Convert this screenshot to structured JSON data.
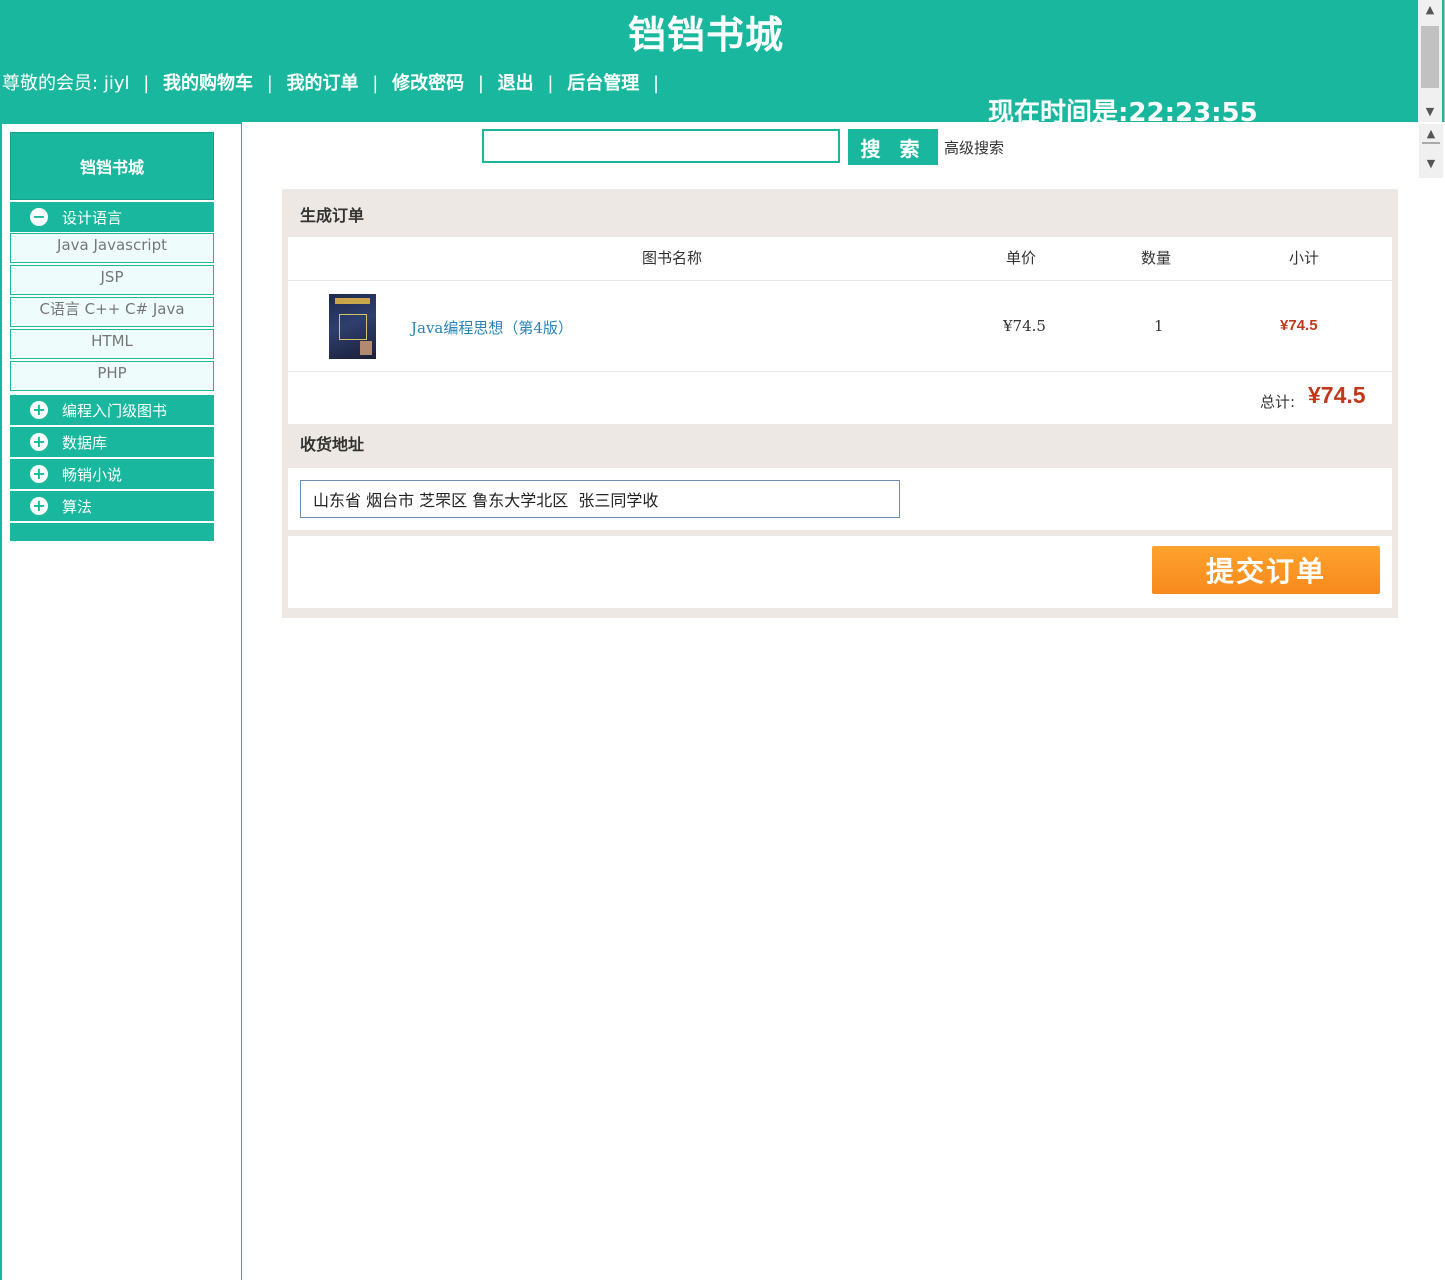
{
  "header": {
    "site_title": "铛铛书城",
    "member_prefix": "尊敬的会员:",
    "member_name": "jiyl",
    "nav": {
      "cart": "我的购物车",
      "orders": "我的订单",
      "change_password": "修改密码",
      "logout": "退出",
      "admin": "后台管理"
    },
    "separator": "|",
    "clock": "现在时间是:22:23:55"
  },
  "sidebar": {
    "title": "铛铛书城",
    "categories": [
      {
        "label": "设计语言",
        "icon": "minus-circle-icon",
        "expanded": true,
        "children": [
          "Java Javascript",
          "JSP",
          "C语言 C++ C# Java",
          "HTML",
          "PHP"
        ]
      },
      {
        "label": "编程入门级图书",
        "icon": "plus-circle-icon"
      },
      {
        "label": "数据库",
        "icon": "plus-circle-icon"
      },
      {
        "label": "畅销小说",
        "icon": "plus-circle-icon"
      },
      {
        "label": "算法",
        "icon": "plus-circle-icon"
      }
    ]
  },
  "search": {
    "value": "",
    "button_label": "搜 索",
    "advanced_label": "高级搜索"
  },
  "order": {
    "title": "生成订单",
    "columns": {
      "name": "图书名称",
      "price": "单价",
      "qty": "数量",
      "subtotal": "小计"
    },
    "items": [
      {
        "name": "Java编程思想（第4版）",
        "price": "¥74.5",
        "qty": "1",
        "subtotal": "¥74.5"
      }
    ],
    "total_label": "总计:",
    "total_value": "¥74.5"
  },
  "address": {
    "title": "收货地址",
    "value": "山东省 烟台市 芝罘区 鲁东大学北区  张三同学收"
  },
  "submit_label": "提交订单",
  "colors": {
    "brand": "#19b89e",
    "price": "#c0391b",
    "submit": "#f7891e",
    "link": "#2a83b5"
  }
}
